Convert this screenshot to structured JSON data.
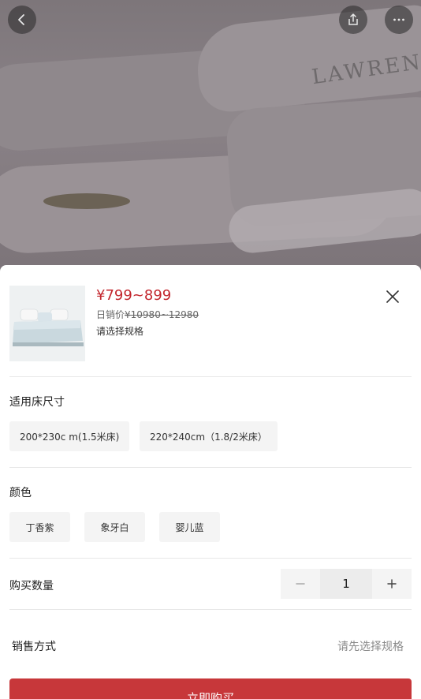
{
  "hero": {
    "monogram_text": "LAWRENC"
  },
  "nav": {
    "back_icon": "chevron-left-icon",
    "share_icon": "share-icon",
    "more_icon": "more-dots-icon"
  },
  "product": {
    "price": "¥799~899",
    "orig_label": "日销价",
    "orig_price": "¥10980~12980",
    "spec_hint": "请选择规格"
  },
  "size_section": {
    "title": "适用床尺寸",
    "options": [
      "200*230c m(1.5米床)",
      "220*240cm（1.8/2米床）"
    ]
  },
  "color_section": {
    "title": "颜色",
    "options": [
      "丁香紫",
      "象牙白",
      "婴儿蓝"
    ]
  },
  "quantity": {
    "label": "购买数量",
    "value": "1"
  },
  "sale": {
    "label": "销售方式",
    "value": "请先选择规格"
  },
  "buy_button": "立即购买",
  "colors": {
    "accent": "#c3262d",
    "button": "#c7373a"
  }
}
